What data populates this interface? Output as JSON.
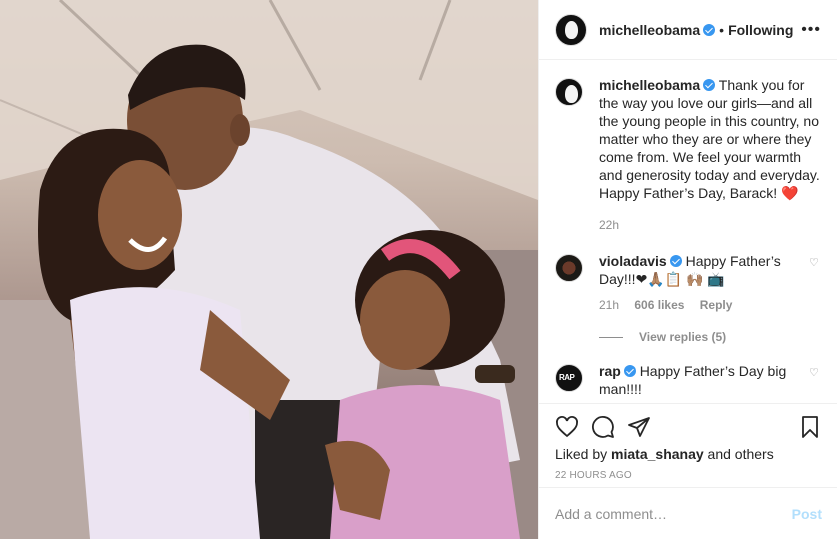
{
  "header": {
    "username": "michelleobama",
    "separator": "•",
    "follow_status": "Following",
    "more_label": "•••"
  },
  "caption": {
    "username": "michelleobama",
    "text": "Thank you for the way you love our girls—and all the young people in this country, no matter who they are or where they come from. We feel your warmth and generosity today and everyday. Happy Father’s Day, Barack! ❤️",
    "time": "22h"
  },
  "comments": [
    {
      "username": "violadavis",
      "text": "Happy Father’s Day!!!❤🙏🏽📋 🙌🏽 📺",
      "time": "21h",
      "likes": "606 likes",
      "reply": "Reply",
      "view_replies": "View replies (5)",
      "heart": "♡"
    },
    {
      "username": "rap",
      "avatar_text": "RAP",
      "text": "Happy Father’s Day big man!!!!",
      "heart": "♡"
    }
  ],
  "actions": {
    "liked_by_prefix": "Liked by ",
    "liked_by_user": "miata_shanay",
    "liked_by_suffix": " and others",
    "timestamp": "22 HOURS AGO"
  },
  "add_comment": {
    "placeholder": "Add a comment…",
    "post_label": "Post"
  },
  "colors": {
    "verified": "#3897f0",
    "heart": "#ed4956",
    "post_button": "#b2dffc"
  }
}
